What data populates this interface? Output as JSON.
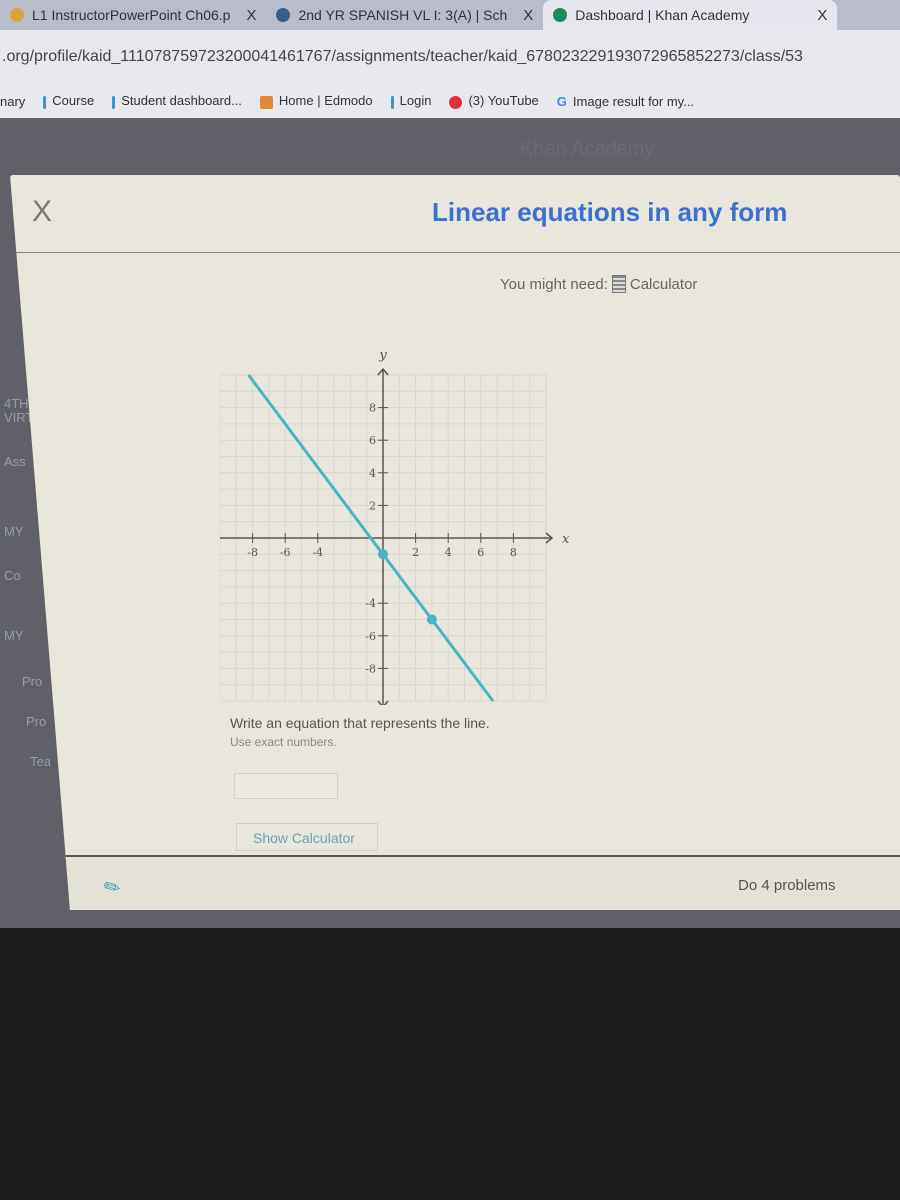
{
  "browser": {
    "tabs": [
      {
        "label": "L1 InstructorPowerPoint Ch06.p",
        "active": false,
        "icon_color": "#d9a43b"
      },
      {
        "label": "2nd YR SPANISH VL I: 3(A) | Sch",
        "active": false,
        "icon_color": "#3a5e8a"
      },
      {
        "label": "Dashboard | Khan Academy",
        "active": true,
        "icon_color": "#1f8a5c"
      }
    ],
    "tab_close": "X",
    "url": ".org/profile/kaid_111078759723200041461767/assignments/teacher/kaid_678023229193072965852273/class/53",
    "bookmarks": [
      {
        "label": "nary",
        "icon_color": ""
      },
      {
        "label": "Course",
        "icon_color": "#4a8fc7"
      },
      {
        "label": "Student dashboard...",
        "icon_color": "#4a8fc7"
      },
      {
        "label": "Home | Edmodo",
        "icon_color": "#e08b3c"
      },
      {
        "label": "Login",
        "icon_color": "#4a8fc7"
      },
      {
        "label": "(3) YouTube",
        "icon_color": "#e0303a"
      },
      {
        "label": "Image result for my...",
        "icon_color": "#4285f4"
      }
    ]
  },
  "background": {
    "brand": "Khan Academy",
    "sidebar": [
      "4TH",
      "VIRT",
      "Ass",
      "MY",
      "Co",
      "MY",
      "Pro",
      "Pro",
      "Tea"
    ]
  },
  "modal": {
    "close": "X",
    "title": "Linear equations in any form",
    "you_might_need": "You might need:",
    "calculator": "Calculator",
    "question": "Write an equation that represents the line.",
    "hint": "Use exact numbers.",
    "answer_value": "",
    "show_calculator": "Show Calculator",
    "do_problems": "Do 4 problems",
    "accent": "#3b6fd4",
    "line_color": "#4bb3c3"
  },
  "chart_data": {
    "type": "line",
    "xlabel": "x",
    "ylabel": "y",
    "xlim": [
      -10,
      10
    ],
    "ylim": [
      -10,
      10
    ],
    "grid": true,
    "x_ticks": [
      "-8",
      "-6",
      "-4",
      "2",
      "4",
      "6",
      "8"
    ],
    "y_ticks": [
      "8",
      "6",
      "4",
      "2",
      "-4",
      "-6",
      "-8"
    ],
    "points": [
      {
        "x": 0,
        "y": -1
      },
      {
        "x": 3,
        "y": -5
      }
    ]
  }
}
